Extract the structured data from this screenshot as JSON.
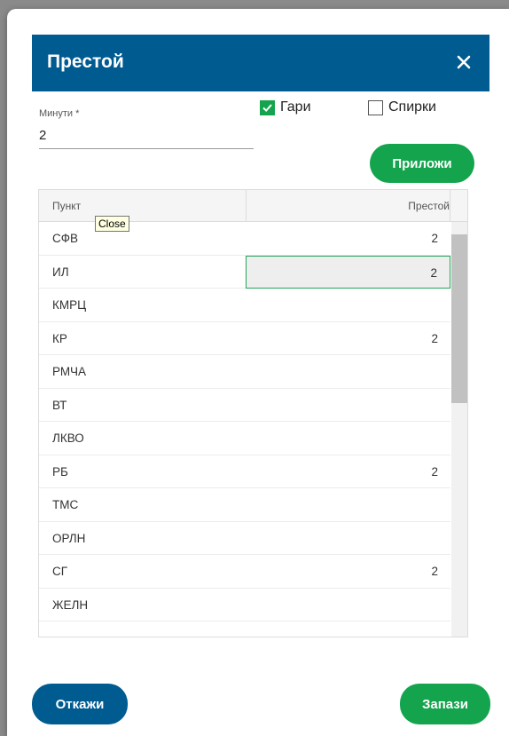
{
  "dialog": {
    "title": "Престой",
    "close_tooltip": "Close"
  },
  "minutes": {
    "label": "Минути *",
    "value": "2"
  },
  "checkboxes": [
    {
      "label": "Гари",
      "checked": true
    },
    {
      "label": "Спирки",
      "checked": false
    }
  ],
  "apply_button": "Приложи",
  "table": {
    "columns": [
      "Пункт",
      "Престой"
    ],
    "rows": [
      {
        "point": "СФВ",
        "value": "2"
      },
      {
        "point": "ИЛ",
        "value": "2"
      },
      {
        "point": "КМРЦ",
        "value": ""
      },
      {
        "point": "КР",
        "value": "2"
      },
      {
        "point": "РМЧА",
        "value": ""
      },
      {
        "point": "ВТ",
        "value": ""
      },
      {
        "point": "ЛКВО",
        "value": ""
      },
      {
        "point": "РБ",
        "value": "2"
      },
      {
        "point": "ТМС",
        "value": ""
      },
      {
        "point": "ОРЛН",
        "value": ""
      },
      {
        "point": "СГ",
        "value": "2"
      },
      {
        "point": "ЖЕЛН",
        "value": ""
      }
    ]
  },
  "footer": {
    "cancel": "Откажи",
    "save": "Запази"
  },
  "colors": {
    "primary": "#005b91",
    "success": "#14a44d"
  }
}
